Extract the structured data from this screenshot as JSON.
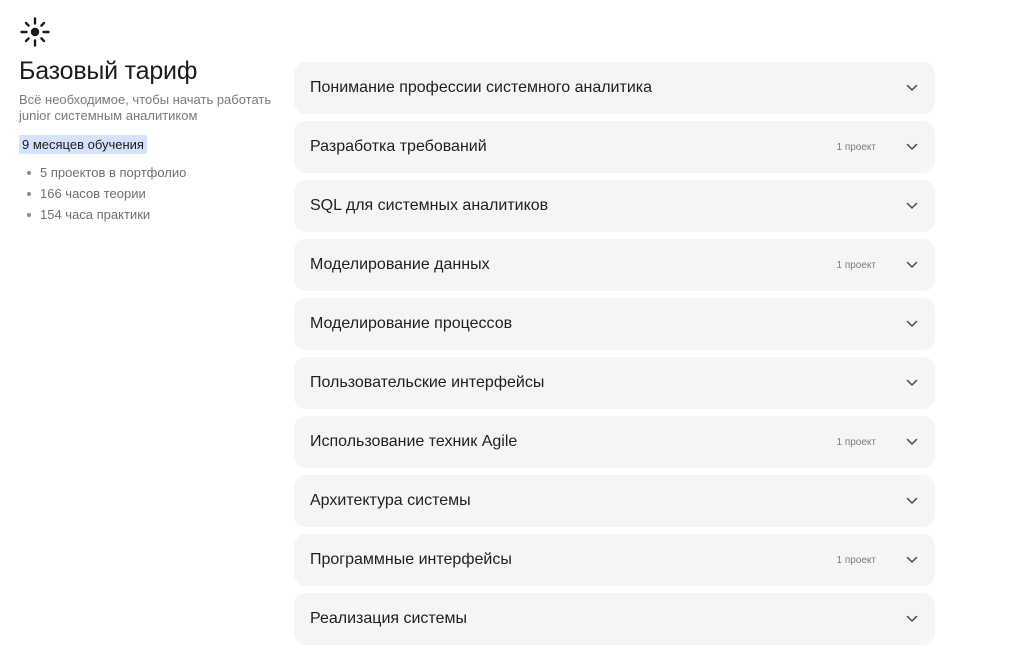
{
  "brand": {
    "logo_icon": "sparkle-sun-icon"
  },
  "plan": {
    "title": "Базовый тариф",
    "subtitle": "Всё необходимое, чтобы начать работать junior системным аналитиком",
    "duration": "9 месяцев обучения",
    "duration_bg": "#d3e3fb",
    "features": [
      "5 проектов в портфолио",
      "166 часов теории",
      "154 часа практики"
    ]
  },
  "modules": [
    {
      "title": "Понимание профессии системного аналитика",
      "badge": ""
    },
    {
      "title": "Разработка требований",
      "badge": "1 проект"
    },
    {
      "title": "SQL для системных аналитиков",
      "badge": ""
    },
    {
      "title": "Моделирование данных",
      "badge": "1 проект"
    },
    {
      "title": "Моделирование процессов",
      "badge": ""
    },
    {
      "title": "Пользовательские интерфейсы",
      "badge": ""
    },
    {
      "title": "Использование техник Agile",
      "badge": "1 проект"
    },
    {
      "title": "Архитектура системы",
      "badge": ""
    },
    {
      "title": "Программные интерфейсы",
      "badge": "1 проект"
    },
    {
      "title": "Реализация системы",
      "badge": ""
    }
  ],
  "icons": {
    "expand": "chevron-down-icon"
  },
  "colors": {
    "card_bg": "#f5f5f4",
    "text": "#21201f",
    "muted": "#7a7a78"
  }
}
